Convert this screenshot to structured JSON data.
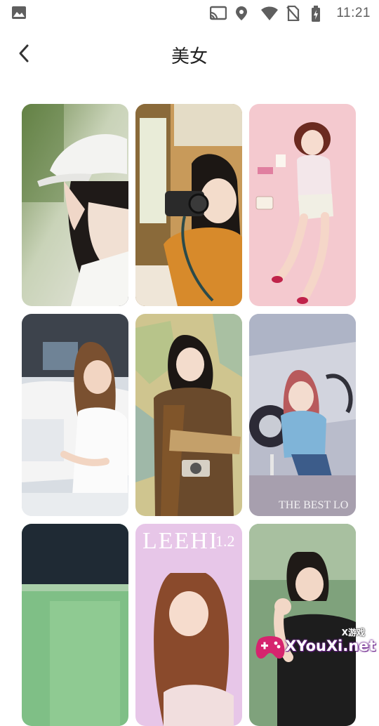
{
  "status_bar": {
    "time": "11:21",
    "icons": [
      "image-notification-icon",
      "cast-icon",
      "location-icon",
      "wifi-icon",
      "no-sim-icon",
      "battery-charging-icon"
    ]
  },
  "header": {
    "back_icon": "chevron-left-icon",
    "title": "美女"
  },
  "gallery": {
    "overlay_texts": {
      "card_6": "THE BEST LO",
      "card_8_brand": "LEEHI",
      "card_8_num": "1.2"
    }
  },
  "watermark": {
    "site": "XYouXi.net",
    "sub": "X游戏"
  },
  "colors": {
    "background": "#ffffff",
    "title": "#222222",
    "status_icons": "#5f5f5f"
  }
}
